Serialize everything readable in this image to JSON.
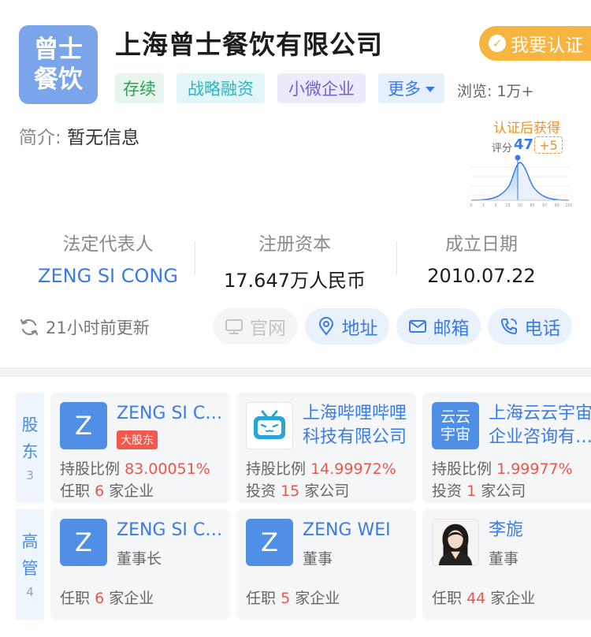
{
  "company": {
    "logo_lines": [
      "曾士",
      "餐饮"
    ],
    "name": "上海曾士餐饮有限公司",
    "certify_label": "我要认证",
    "tags": [
      "存续",
      "战略融资",
      "小微企业",
      "更多"
    ],
    "views": "浏览: 1万+"
  },
  "intro": {
    "label": "简介:",
    "value": "暂无信息"
  },
  "score": {
    "title": "认证后获得",
    "label": "评分",
    "value": "47",
    "plus": "+5",
    "axis_ticks": [
      "0",
      "1",
      "3",
      "15",
      "50",
      "85",
      "97",
      "99",
      "100"
    ]
  },
  "stats": [
    {
      "label": "法定代表人",
      "value": "ZENG SI CONG"
    },
    {
      "label": "注册资本",
      "value": "17.647万人民币"
    },
    {
      "label": "成立日期",
      "value": "2010.07.22"
    }
  ],
  "update_text": "21小时前更新",
  "actions": {
    "website": "官网",
    "address": "地址",
    "email": "邮箱",
    "phone": "电话"
  },
  "shareholders": {
    "title_lines": [
      "股",
      "东"
    ],
    "count": "3",
    "items": [
      {
        "avatar": "Z",
        "name": "ZENG SI CONG",
        "badge": "大股东",
        "share_label": "持股比例",
        "share": "83.00051%",
        "line2_prefix": "任职",
        "line2_num": "6",
        "line2_suffix": "家企业"
      },
      {
        "avatar": "bilibili-tv-icon",
        "name": "上海哔哩哔哩科技有限公司",
        "share_label": "持股比例",
        "share": "14.99972%",
        "line2_prefix": "投资",
        "line2_num": "15",
        "line2_suffix": "家公司"
      },
      {
        "avatar_lines": [
          "云云",
          "宇宙"
        ],
        "name": "上海云云宇宙企业咨询有限公司",
        "share_label": "持股比例",
        "share": "1.99977%",
        "line2_prefix": "投资",
        "line2_num": "1",
        "line2_suffix": "家公司"
      }
    ]
  },
  "executives": {
    "title_lines": [
      "高",
      "管"
    ],
    "count": "4",
    "items": [
      {
        "avatar": "Z",
        "name": "ZENG SI CONG",
        "role": "董事长",
        "line_prefix": "任职",
        "line_num": "6",
        "line_suffix": "家企业"
      },
      {
        "avatar": "Z",
        "name": "ZENG WEI",
        "role": "董事",
        "line_prefix": "任职",
        "line_num": "5",
        "line_suffix": "家企业"
      },
      {
        "avatar": "person-photo",
        "name": "李旎",
        "role": "董事",
        "line_prefix": "任职",
        "line_num": "44",
        "line_suffix": "家企业"
      }
    ]
  },
  "colors": {
    "brand_blue": "#3b7be8",
    "certify_orange": "#f7b43f",
    "highlight_red": "#e8584d"
  }
}
